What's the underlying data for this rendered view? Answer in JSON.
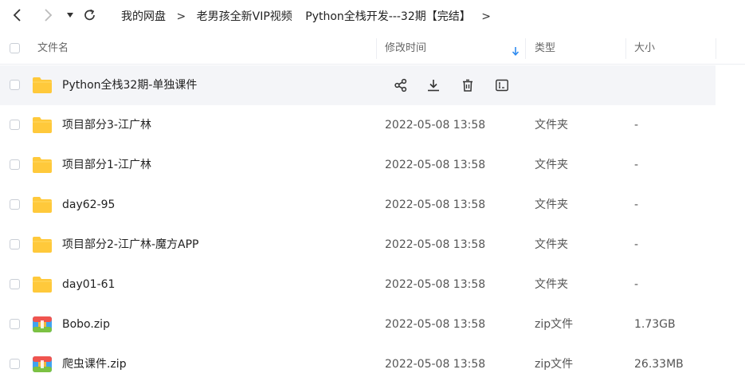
{
  "breadcrumb": {
    "items": [
      "我的网盘",
      "老男孩全新VIP视频",
      "Python全栈开发---32期【完结】"
    ],
    "separator": ">"
  },
  "header": {
    "name": "文件名",
    "modified": "修改时间",
    "type": "类型",
    "size": "大小"
  },
  "rows": [
    {
      "name": "Python全栈32期-单独课件",
      "time": "",
      "type": "",
      "size": "",
      "kind": "folder",
      "hover": true
    },
    {
      "name": "项目部分3-江广林",
      "time": "2022-05-08 13:58",
      "type": "文件夹",
      "size": "-",
      "kind": "folder"
    },
    {
      "name": "项目部分1-江广林",
      "time": "2022-05-08 13:58",
      "type": "文件夹",
      "size": "-",
      "kind": "folder"
    },
    {
      "name": "day62-95",
      "time": "2022-05-08 13:58",
      "type": "文件夹",
      "size": "-",
      "kind": "folder"
    },
    {
      "name": "项目部分2-江广林-魔方APP",
      "time": "2022-05-08 13:58",
      "type": "文件夹",
      "size": "-",
      "kind": "folder"
    },
    {
      "name": "day01-61",
      "time": "2022-05-08 13:58",
      "type": "文件夹",
      "size": "-",
      "kind": "folder"
    },
    {
      "name": "Bobo.zip",
      "time": "2022-05-08 13:58",
      "type": "zip文件",
      "size": "1.73GB",
      "kind": "zip"
    },
    {
      "name": "爬虫课件.zip",
      "time": "2022-05-08 13:58",
      "type": "zip文件",
      "size": "26.33MB",
      "kind": "zip"
    }
  ],
  "colors": {
    "folder": "#ffc93b",
    "accent": "#2e8bf0"
  }
}
